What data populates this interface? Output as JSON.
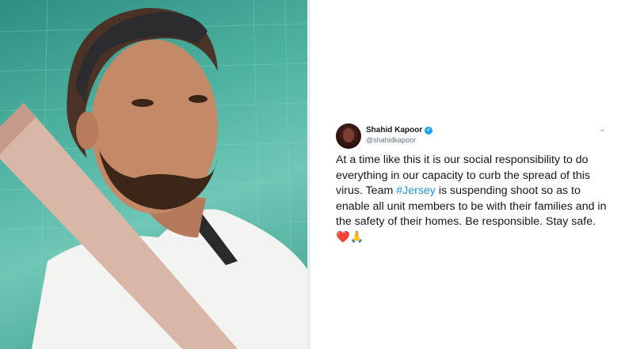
{
  "tweet": {
    "display_name": "Shahid Kapoor",
    "handle": "@shahidkapoor",
    "text_part1": "At a time like this it is our social responsibility to do everything in our capacity to curb the spread of this virus. Team ",
    "hashtag": "#Jersey",
    "text_part2": " is suspending shoot so as to enable all unit members to be with their families and in the safety of their homes. Be responsible. Stay safe.",
    "emoji_heart": "❤️",
    "emoji_hands": "🙏",
    "verified_glyph": "✓",
    "menu_glyph": "⌄"
  },
  "photo": {
    "description_icon": "actor-with-bat-photo"
  },
  "colors": {
    "link": "#1b95e0",
    "verified": "#1da1f2",
    "background_net": "#4fb3a2"
  }
}
